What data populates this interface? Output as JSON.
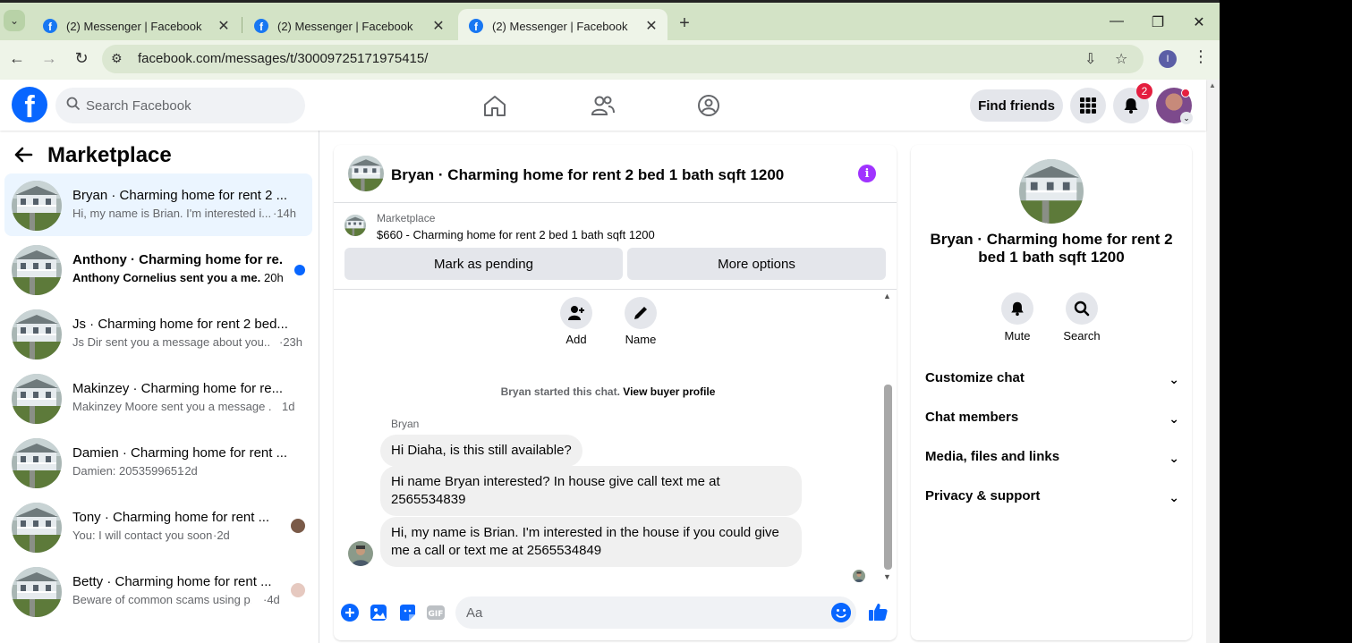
{
  "browser": {
    "tabs": [
      {
        "title": "(2) Messenger | Facebook",
        "active": false
      },
      {
        "title": "(2) Messenger | Facebook",
        "active": false
      },
      {
        "title": "(2) Messenger | Facebook",
        "active": true
      }
    ],
    "url": "facebook.com/messages/t/30009725171975415/",
    "profile_initial": "I"
  },
  "header": {
    "search_placeholder": "Search Facebook",
    "find_friends": "Find friends",
    "notification_count": "2"
  },
  "sidebar": {
    "title": "Marketplace",
    "conversations": [
      {
        "name": "Bryan · Charming home for rent 2 ...",
        "snippet": "Hi, my name is Brian. I'm interested i...",
        "time": "·14h",
        "active": true,
        "unread": false
      },
      {
        "name": "Anthony · Charming home for re...",
        "snippet": "Anthony Cornelius sent you a me...",
        "time": "20h",
        "active": false,
        "unread": true
      },
      {
        "name": "Js · Charming home for rent 2 bed...",
        "snippet": "Js Dir sent you a message about you...",
        "time": "·23h",
        "active": false,
        "unread": false
      },
      {
        "name": "Makinzey · Charming home for re...",
        "snippet": "Makinzey Moore sent you a message ...",
        "time": "1d",
        "active": false,
        "unread": false
      },
      {
        "name": "Damien · Charming home for rent ...",
        "snippet": "Damien: 2053599651",
        "time": "·2d",
        "active": false,
        "unread": false
      },
      {
        "name": "Tony · Charming home for rent ...",
        "snippet": "You: I will contact you soon",
        "time": "·2d",
        "active": false,
        "unread": false
      },
      {
        "name": "Betty · Charming home for rent ...",
        "snippet": "Beware of common scams using p...",
        "time": "·4d",
        "active": false,
        "unread": false
      }
    ]
  },
  "chat": {
    "title": "Bryan · Charming home for rent 2 bed 1 bath sqft 1200",
    "marketplace_label": "Marketplace",
    "listing": "$660 - Charming home for rent 2 bed 1 bath sqft 1200",
    "mark_pending": "Mark as pending",
    "more_options": "More options",
    "add_label": "Add",
    "name_label": "Name",
    "started_text": "Bryan started this chat.",
    "view_buyer": "View buyer profile",
    "sender": "Bryan",
    "messages": [
      "Hi Diaha, is this still available?",
      "Hi name Bryan interested? In house give call text me at 2565534839",
      "Hi, my name is Brian. I'm interested in the house if you could give me a call or text me at 2565534849"
    ],
    "composer_placeholder": "Aa"
  },
  "details": {
    "title": "Bryan · Charming home for rent 2 bed 1 bath sqft 1200",
    "mute": "Mute",
    "search": "Search",
    "sections": [
      "Customize chat",
      "Chat members",
      "Media, files and links",
      "Privacy & support"
    ]
  },
  "colors": {
    "brand": "#0866ff",
    "tabstrip": "#d3e3c6",
    "info_purple": "#a033ff",
    "active_conversation": "#ebf5ff"
  }
}
